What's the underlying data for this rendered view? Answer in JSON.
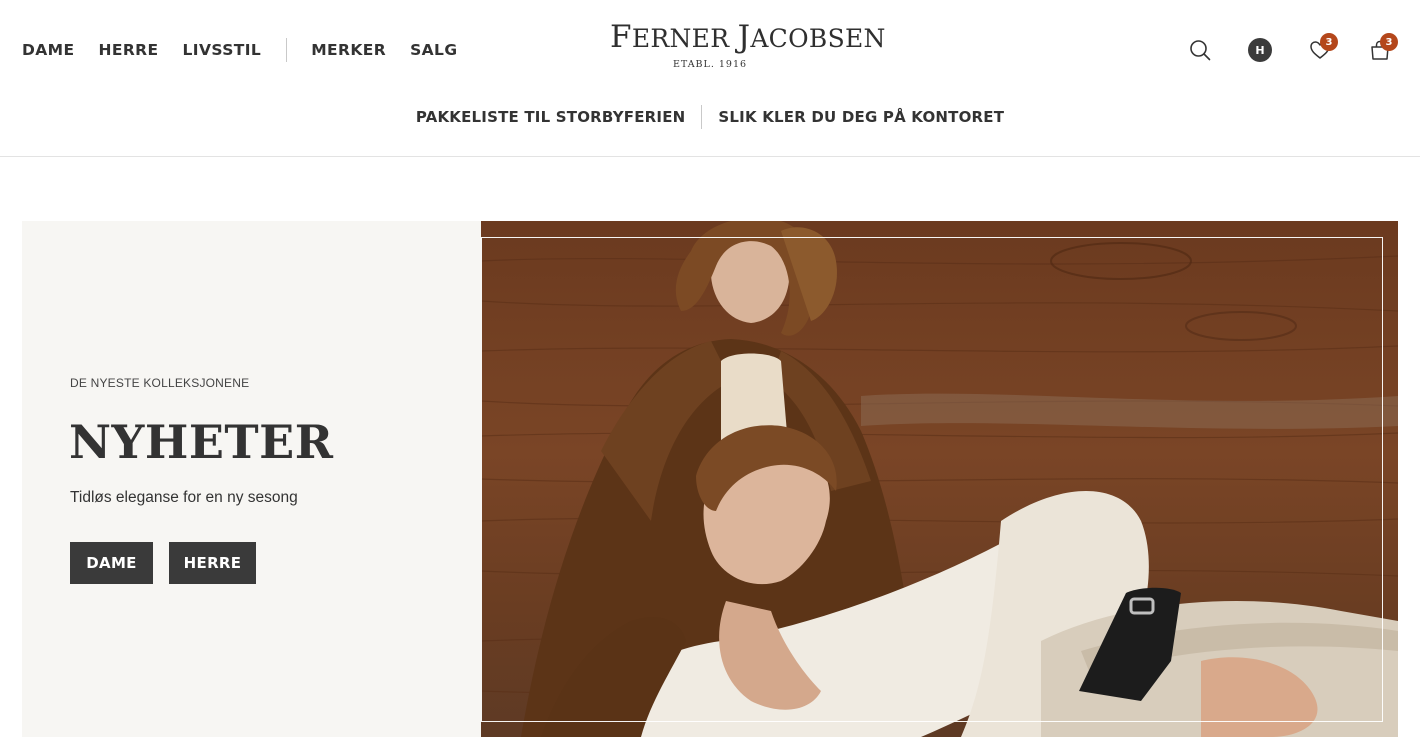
{
  "header": {
    "main_nav": [
      "DAME",
      "HERRE",
      "LIVSSTIL",
      "MERKER",
      "SALG"
    ],
    "logo": {
      "name_first_initial": "F",
      "name_first_rest": "ERNER",
      "name_second_initial": "J",
      "name_second_rest": "ACOBSEN",
      "estab": "ETABL. 1916"
    },
    "icons": {
      "search": "search-icon",
      "account": {
        "icon": "avatar-icon",
        "initial": "H"
      },
      "wishlist": {
        "icon": "heart-icon",
        "count": "3"
      },
      "cart": {
        "icon": "bag-icon",
        "count": "3"
      }
    },
    "sub_nav": [
      "PAKKELISTE TIL STORBYFERIEN",
      "SLIK KLER DU DEG PÅ KONTORET"
    ]
  },
  "hero": {
    "eyebrow": "DE NYESTE KOLLEKSJONENE",
    "title": "NYHETER",
    "subtitle": "Tidløs eleganse for en ny sesong",
    "buttons": [
      "DAME",
      "HERRE"
    ]
  },
  "colors": {
    "badge": "#b4471b",
    "button": "#3a3a3a",
    "panel": "#f7f6f3",
    "text": "#333333"
  }
}
